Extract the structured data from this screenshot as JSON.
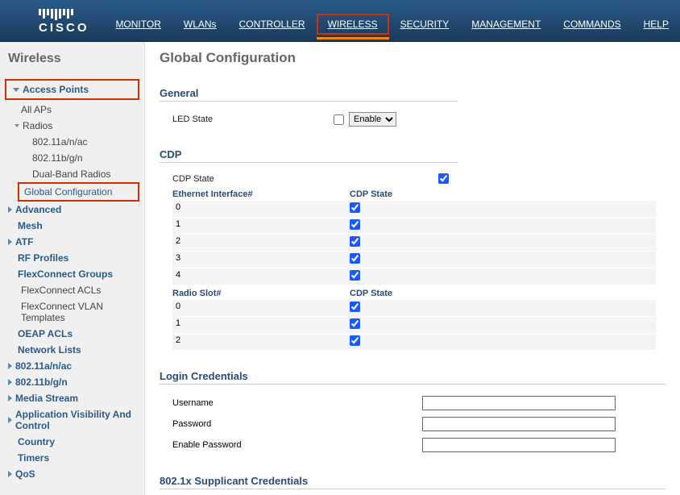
{
  "brand": "CISCO",
  "nav": {
    "monitor": "MONITOR",
    "wlans": "WLANs",
    "controller": "CONTROLLER",
    "wireless": "WIRELESS",
    "security": "SECURITY",
    "management": "MANAGEMENT",
    "commands": "COMMANDS",
    "help": "HELP"
  },
  "sidebar": {
    "title": "Wireless",
    "access_points": "Access Points",
    "all_aps": "All APs",
    "radios": "Radios",
    "r_11a": "802.11a/n/ac",
    "r_11b": "802.11b/g/n",
    "r_dual": "Dual-Band Radios",
    "global_conf": "Global Configuration",
    "advanced": "Advanced",
    "mesh": "Mesh",
    "atf": "ATF",
    "rf": "RF Profiles",
    "flexgroups": "FlexConnect Groups",
    "flexacls": "FlexConnect ACLs",
    "flexvlan": "FlexConnect VLAN Templates",
    "oeap": "OEAP ACLs",
    "network": "Network Lists",
    "s_11a": "802.11a/n/ac",
    "s_11b": "802.11b/g/n",
    "media": "Media Stream",
    "appvis": "Application Visibility And Control",
    "country": "Country",
    "timers": "Timers",
    "qos": "QoS"
  },
  "page": {
    "title": "Global Configuration",
    "general": {
      "title": "General",
      "led_label": "LED State",
      "led_option": "Enable"
    },
    "cdp": {
      "title": "CDP",
      "state_label": "CDP State",
      "eth_header": "Ethernet Interface#",
      "cdp_header": "CDP State",
      "eth": [
        "0",
        "1",
        "2",
        "3",
        "4"
      ],
      "radio_header": "Radio Slot#",
      "radio": [
        "0",
        "1",
        "2"
      ]
    },
    "login": {
      "title": "Login Credentials",
      "username": "Username",
      "password": "Password",
      "enable_password": "Enable Password"
    },
    "dot1x": {
      "title": "802.1x Supplicant Credentials"
    }
  }
}
